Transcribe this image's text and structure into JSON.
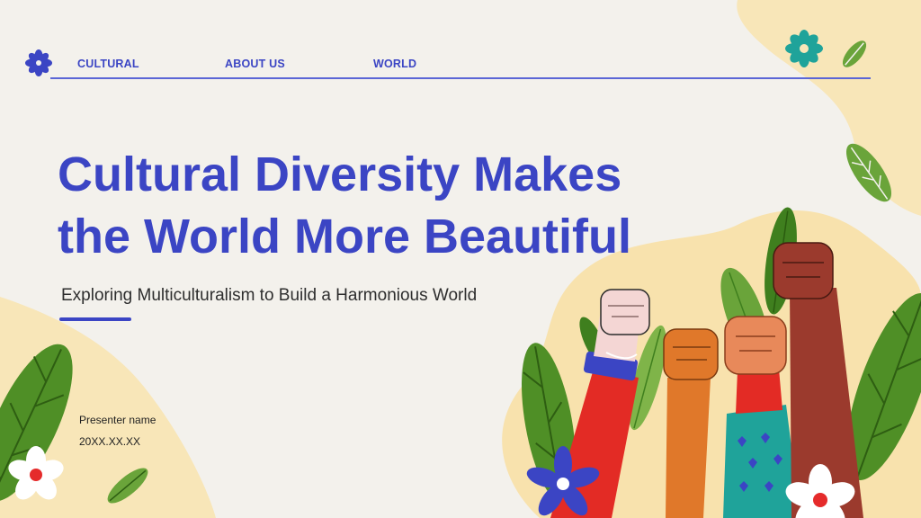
{
  "nav": {
    "items": [
      {
        "label": "CULTURAL"
      },
      {
        "label": "ABOUT US"
      },
      {
        "label": "WORLD"
      }
    ]
  },
  "hero": {
    "title_line1": "Cultural Diversity Makes",
    "title_line2": "the World More Beautiful",
    "subtitle": "Exploring Multiculturalism to Build a Harmonious World"
  },
  "presenter": {
    "name_label": "Presenter name",
    "date": "20XX.XX.XX"
  },
  "colors": {
    "accent": "#3b45c4",
    "background": "#f3f1ec",
    "blob": "#f8e3b0",
    "leaf": "#5c9a2e",
    "teal": "#1fa39a"
  },
  "icons": [
    "flower-logo-icon",
    "teal-flower-icon",
    "leaf-icon",
    "white-flower-icon",
    "blue-flower-icon",
    "raised-fist-icon"
  ]
}
